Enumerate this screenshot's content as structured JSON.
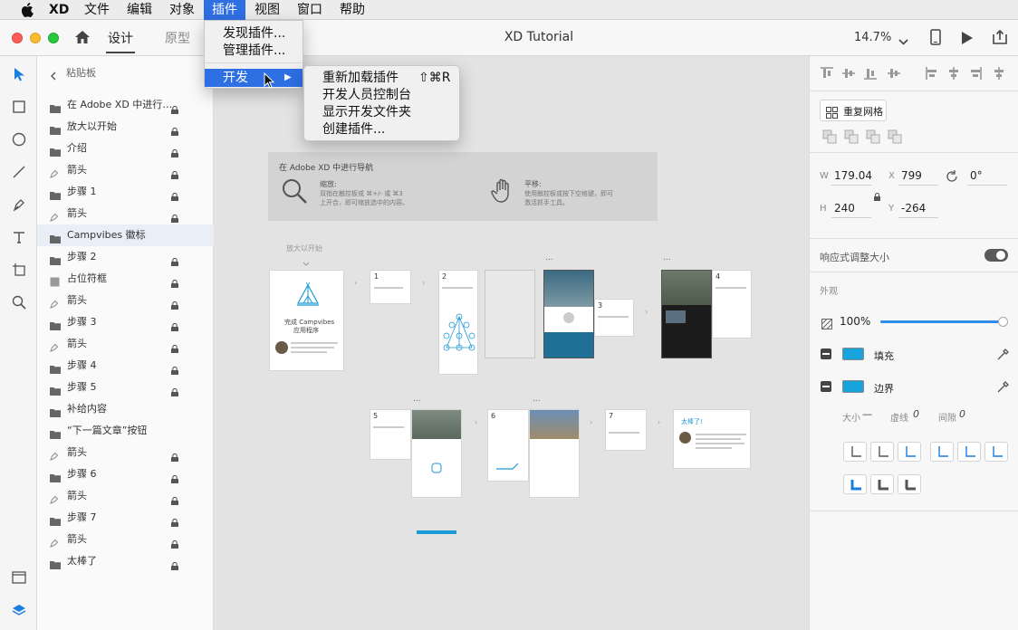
{
  "menubar": {
    "app": "XD",
    "items": [
      "文件",
      "编辑",
      "对象",
      "插件",
      "视图",
      "窗口",
      "帮助"
    ],
    "active": "插件"
  },
  "plugin_menu": {
    "items": [
      "发现插件...",
      "管理插件..."
    ],
    "develop": "开发"
  },
  "develop_submenu": {
    "items": [
      {
        "label": "重新加载插件",
        "shortcut": "⇧⌘R"
      },
      {
        "label": "开发人员控制台",
        "shortcut": ""
      },
      {
        "label": "显示开发文件夹",
        "shortcut": ""
      },
      {
        "label": "创建插件...",
        "shortcut": ""
      }
    ]
  },
  "titlebar": {
    "tabs": [
      "设计",
      "原型"
    ],
    "title": "XD Tutorial",
    "zoom": "14.7%"
  },
  "layers": {
    "header": "粘贴板",
    "items": [
      {
        "name": "在 Adobe XD 中进行…",
        "type": "folder",
        "locked": true
      },
      {
        "name": "放大以开始",
        "type": "folder",
        "locked": true
      },
      {
        "name": "介绍",
        "type": "folder",
        "locked": true
      },
      {
        "name": "箭头",
        "type": "pen",
        "locked": true
      },
      {
        "name": "步骤 1",
        "type": "folder",
        "locked": true
      },
      {
        "name": "箭头",
        "type": "pen",
        "locked": true
      },
      {
        "name": "Campvibes 徽标",
        "type": "folder",
        "locked": false,
        "selected": true
      },
      {
        "name": "步骤 2",
        "type": "folder",
        "locked": true
      },
      {
        "name": "占位符框",
        "type": "rect",
        "locked": true
      },
      {
        "name": "箭头",
        "type": "pen",
        "locked": true
      },
      {
        "name": "步骤 3",
        "type": "folder",
        "locked": true
      },
      {
        "name": "箭头",
        "type": "pen",
        "locked": true
      },
      {
        "name": "步骤 4",
        "type": "folder",
        "locked": true
      },
      {
        "name": "步骤 5",
        "type": "folder",
        "locked": true
      },
      {
        "name": "补给内容",
        "type": "folder",
        "locked": false
      },
      {
        "name": "“下一篇文章”按钮",
        "type": "folder",
        "locked": false
      },
      {
        "name": "箭头",
        "type": "pen",
        "locked": true
      },
      {
        "name": "步骤 6",
        "type": "folder",
        "locked": true
      },
      {
        "name": "箭头",
        "type": "pen",
        "locked": true
      },
      {
        "name": "步骤 7",
        "type": "folder",
        "locked": true
      },
      {
        "name": "箭头",
        "type": "pen",
        "locked": true
      },
      {
        "name": "太棒了",
        "type": "folder",
        "locked": true
      }
    ]
  },
  "canvas": {
    "nav_title": "在 Adobe XD 中进行导航",
    "zoom_label": "缩放:",
    "zoom_desc1": "双指在触控板或 ⌘+/- 或 ⌘3",
    "zoom_desc2": "上开合，即可缩放选中的内容。",
    "pan_label": "平移:",
    "pan_desc1": "使用触控板或按下空格键，即可",
    "pan_desc2": "激活抓手工具。",
    "start_label": "放大以开始",
    "intro_title": "完成 Campvibes",
    "intro_sub": "应用程序",
    "steps": [
      "1",
      "2",
      "3",
      "4",
      "5",
      "6",
      "7"
    ],
    "final_title": "太棒了!",
    "more": "..."
  },
  "props": {
    "repeat_grid": "重复网格",
    "w_label": "W",
    "w": "179.04",
    "x_label": "X",
    "x": "799",
    "rot": "0°",
    "h_label": "H",
    "h": "240",
    "y_label": "Y",
    "y": "-264",
    "responsive": "响应式调整大小",
    "appearance": "外观",
    "opacity": "100%",
    "opacity_value": 1.0,
    "fill": "填充",
    "border": "边界",
    "size_label": "大小",
    "size_val": "—",
    "dash_label": "虚线",
    "dash_val": "0",
    "gap_label": "间隙",
    "gap_val": "0",
    "fill_color": "#17a3dc",
    "accent": "#2f6fe4"
  }
}
